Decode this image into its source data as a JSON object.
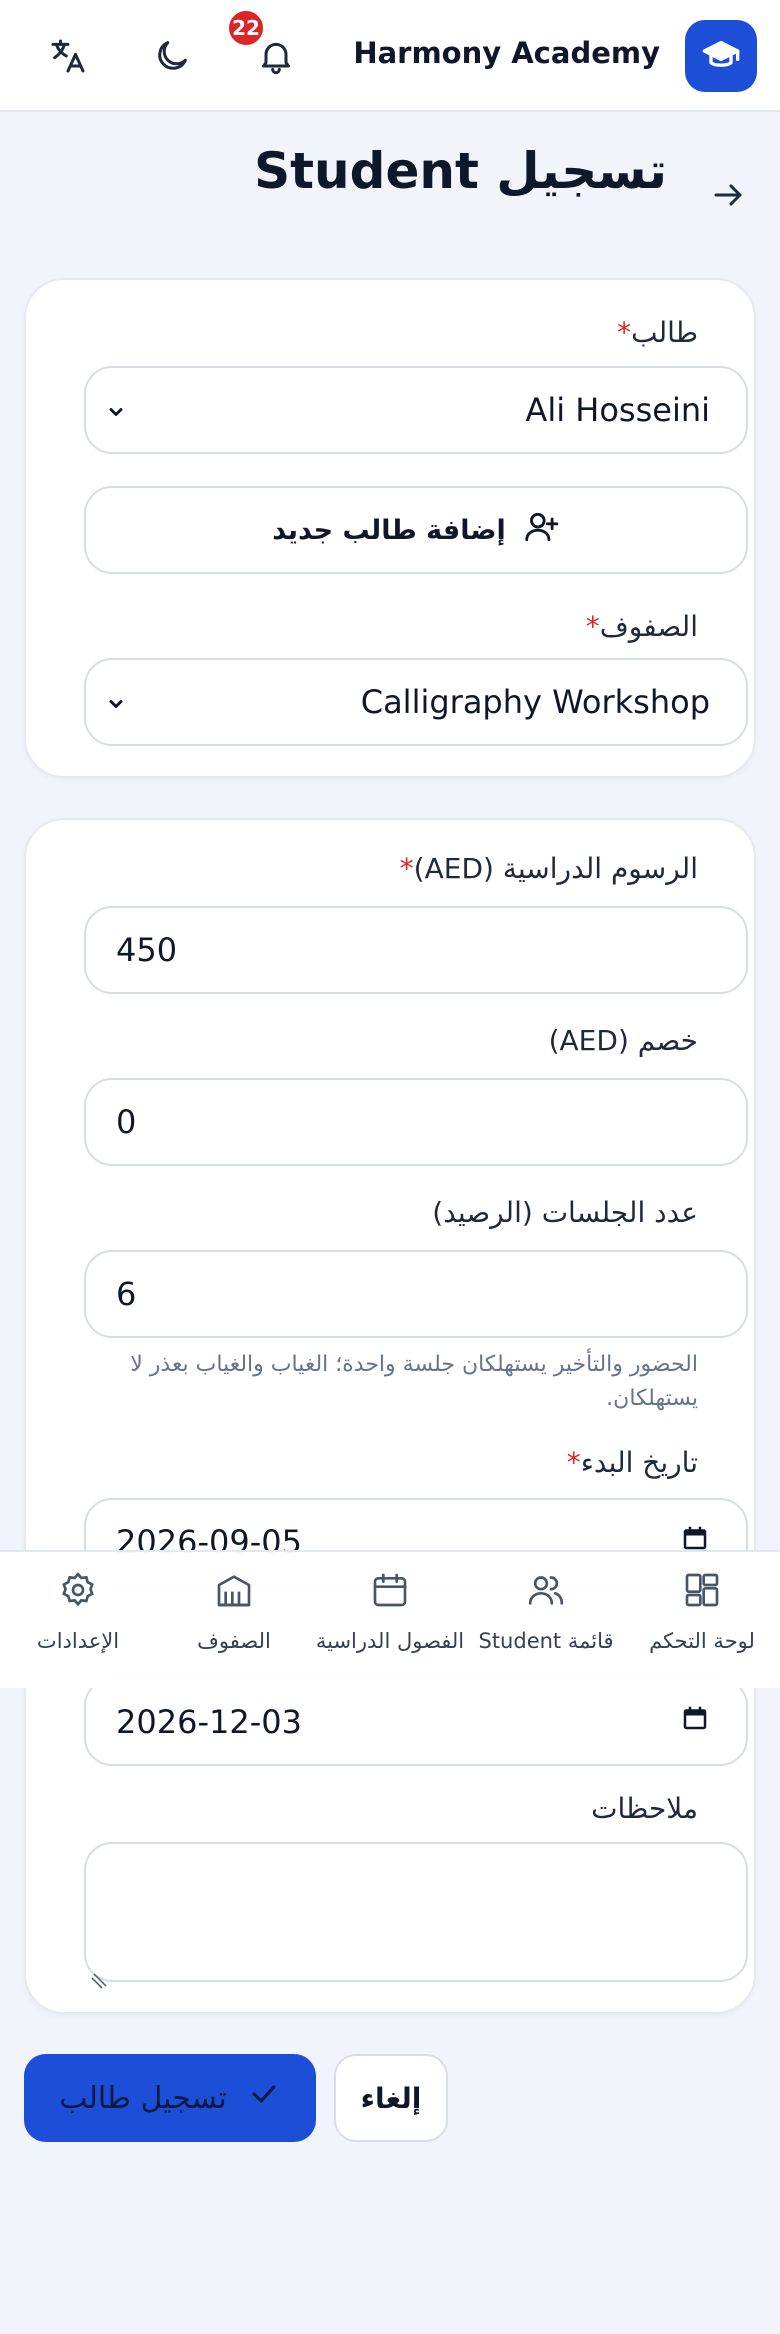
{
  "header": {
    "brand": "Harmony Academy",
    "notification_count": "22",
    "icons": {
      "logo": "graduation-cap-icon",
      "notifications": "bell-icon",
      "theme": "moon-icon",
      "language": "translate-icon"
    }
  },
  "page": {
    "title": "تسجيل Student",
    "back_icon": "arrow-right-icon"
  },
  "form": {
    "student_label": "طالب",
    "student_value": "Ali Hosseini",
    "add_student_label": "إضافة طالب جديد",
    "classes_label": "الصفوف",
    "class_value": "Calligraphy Workshop",
    "fee_label": "الرسوم الدراسية (AED)",
    "fee_value": "450",
    "discount_label": "خصم (AED)",
    "discount_value": "0",
    "sessions_label": "عدد الجلسات (الرصيد)",
    "sessions_value": "6",
    "sessions_hint": "الحضور والتأخير يستهلكان جلسة واحدة؛ الغياب والغياب بعذر لا يستهلكان.",
    "start_date_label": "تاريخ البدء",
    "start_date_value": "2026-09-05",
    "end_date_value": "2026-12-03",
    "notes_label": "ملاحظات",
    "notes_value": "",
    "required_mark": "*"
  },
  "nav": {
    "items": [
      {
        "label": "لوحة التحكم",
        "icon": "dashboard-icon"
      },
      {
        "label": "قائمة Student",
        "icon": "users-icon"
      },
      {
        "label": "الفصول الدراسية",
        "icon": "calendar-icon"
      },
      {
        "label": "الصفوف",
        "icon": "building-icon"
      },
      {
        "label": "الإعدادات",
        "icon": "gear-icon"
      }
    ]
  },
  "actions": {
    "submit_label": "تسجيل طالب",
    "cancel_label": "إلغاء"
  },
  "colors": {
    "primary": "#1d4ed8",
    "danger": "#dc2626",
    "background": "#f1f4fa"
  }
}
